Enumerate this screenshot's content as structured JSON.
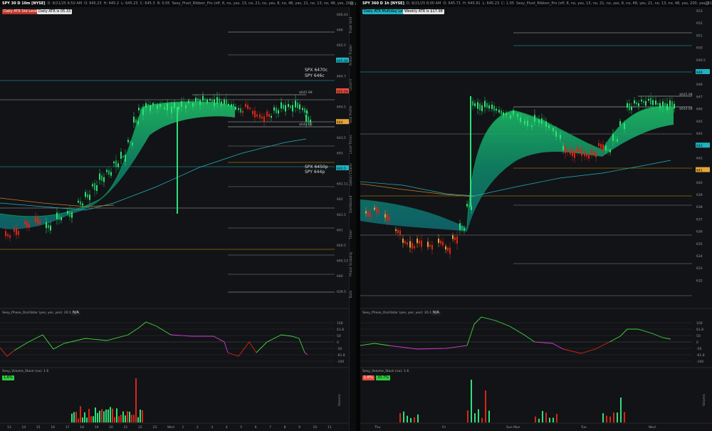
{
  "left": {
    "header": [
      "SPY 30 D 10m [NYSE]",
      "D: 8/21/25 9:50 AM",
      "O: 645.23",
      "H: 645.2",
      "L: 645.23",
      "C: 645.3",
      "R: 0.05",
      "Sexy_Pivot_Ribbon_Pro (off, 8, no, yes, 13, no, 21, no, yes, 8, no, 48, yes, 21, no, 13, no, 48, yes, 200, yes, 21)",
      "N/A"
    ],
    "badges": [
      {
        "text": "Daily ATR Std Levels",
        "bg": "#c0392b",
        "fg": "#ffffff"
      },
      {
        "text": "Daily ATR is 05.33",
        "bg": "#e6e6e6",
        "fg": "#000000"
      }
    ],
    "right_axis": [
      "646.41",
      "646",
      "645.5",
      "645.04",
      "644.7",
      "645.04",
      "644.5",
      "644",
      "643.5",
      "643",
      "642.5",
      "642.11",
      "642",
      "641.5",
      "641",
      "640.5",
      "640.13",
      "640",
      "639.5"
    ],
    "annotations": {
      "a": "SPX 6470c",
      "b": "SPY 646c",
      "c": "SPX 6450p",
      "d": "SPY 644p",
      "e": "$645.98",
      "f": "$644.68"
    },
    "oscillator": {
      "title": "Sexy_Phase_Oscillator (yes, yes, yes): 20.14",
      "na": "N/A",
      "axis": [
        "100",
        "61.8",
        "50",
        "0",
        "-50",
        "-61.8",
        "-100"
      ]
    },
    "volume": {
      "title": "Sexy_Volume_Stack (no): 1.6",
      "badge": "1.6%",
      "axis_label": "Volume"
    },
    "xaxis": [
      "13",
      "14",
      "15",
      "16",
      "17",
      "18",
      "19",
      "20",
      "21",
      "22",
      "23",
      "Wed",
      "1",
      "2",
      "3",
      "4",
      "5",
      "6",
      "7",
      "8",
      "9",
      "10",
      "11"
    ],
    "toolbar": [
      "Trade Grid",
      "Active Trader",
      "Level II",
      "Risk Profile",
      "Level Times",
      "Option Chains",
      "Dashboard",
      "Ticker",
      "Phase Scalping",
      "Tools"
    ]
  },
  "right": {
    "header": [
      "SPY 360 D 1h [NYSE]",
      "D: 8/21/25 8:00 AM",
      "O: 645.71",
      "H: 645.91",
      "L: 645.23",
      "C: 1.05",
      "Sexy_Pivot_Ribbon_Pro (off, 8, no, yes, 13, no, 21, no, yes, 8, no, 48, yes, 21, no, 13, no, 48, yes, 200, yes, 21)",
      "N/A"
    ],
    "badges": [
      {
        "text": "Daily ATR Multiday Levels",
        "bg": "#1fb3c4",
        "fg": "#000000"
      },
      {
        "text": "Weekly ATR is $17.98",
        "bg": "#e6e6e6",
        "fg": "#000000"
      }
    ],
    "right_axis": [
      "653",
      "652",
      "651",
      "650",
      "649.5",
      "649",
      "648",
      "647",
      "646",
      "645",
      "644",
      "643",
      "642",
      "641",
      "640",
      "639",
      "638",
      "637",
      "636",
      "635",
      "634",
      "633",
      "632"
    ],
    "annotations": {
      "a": "$645.98",
      "b": "$644.68"
    },
    "oscillator": {
      "title": "Sexy_Phase_Oscillator (yes, yes, yes): 20.14",
      "na": "N/A",
      "axis": [
        "100",
        "61.8",
        "50",
        "0",
        "-50",
        "-61.8",
        "-100"
      ]
    },
    "volume": {
      "title": "Sexy_Volume_Stack (no): 1.6",
      "badge_a": "1.6%",
      "badge_b": "33.7%",
      "axis_label": "Volume"
    },
    "xaxis": [
      "Thu",
      "Fri",
      "Sun",
      "Mon",
      "Tue",
      "Wed"
    ]
  }
}
